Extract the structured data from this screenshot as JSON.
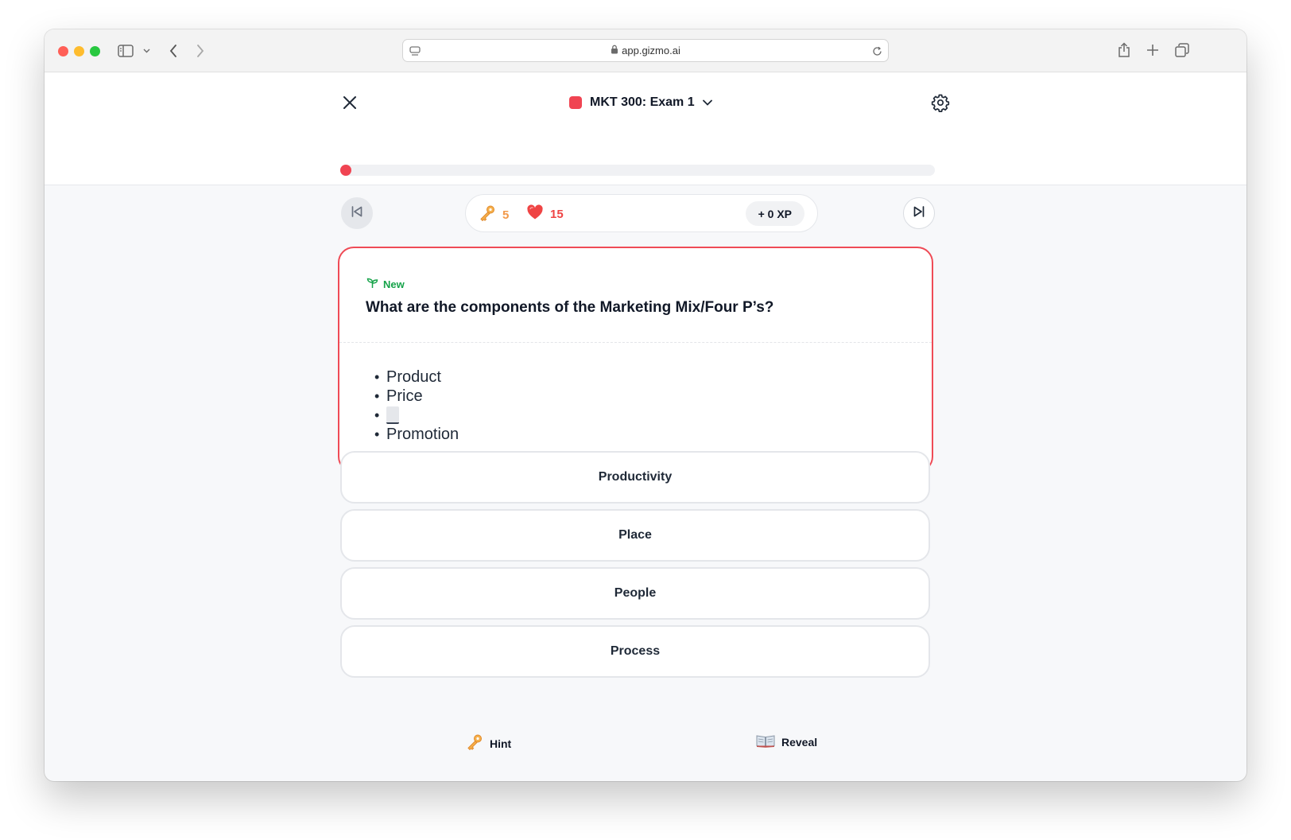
{
  "browser": {
    "url": "app.gizmo.ai",
    "traffic_light_colors": [
      "#ff5f57",
      "#febc2e",
      "#28c840"
    ]
  },
  "header": {
    "deck_title": "MKT 300: Exam 1",
    "deck_color": "#f04452",
    "progress": 0
  },
  "stats": {
    "keys": "5",
    "hearts": "15",
    "xp": "+ 0 XP"
  },
  "card": {
    "tag": "New",
    "tag_color": "#16a34a",
    "question": "What are the components of the Marketing Mix/Four P’s?",
    "answer_items": [
      "Product",
      "Price",
      "_",
      "Promotion"
    ],
    "border_color": "#ef4b56"
  },
  "options": [
    "Productivity",
    "Place",
    "People",
    "Process"
  ],
  "actions": {
    "hint": "Hint",
    "reveal": "Reveal"
  }
}
